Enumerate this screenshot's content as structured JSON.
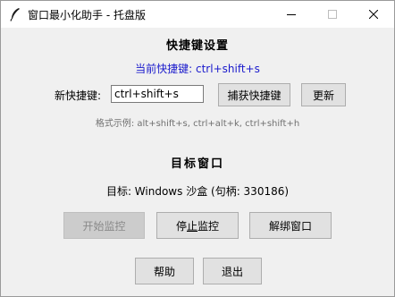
{
  "window": {
    "title": "窗口最小化助手 - 托盘版"
  },
  "hotkey_section": {
    "heading": "快捷键设置",
    "current_label": "当前快捷键: ctrl+shift+s",
    "new_label": "新快捷键:",
    "input_value": "ctrl+shift+s",
    "capture_button": "捕获快捷键",
    "update_button": "更新",
    "format_hint": "格式示例: alt+shift+s, ctrl+alt+k, ctrl+shift+h"
  },
  "target_section": {
    "heading": "目标窗口",
    "target_info": "目标: Windows 沙盒 (句柄: 330186)"
  },
  "monitor_buttons": {
    "start": "开始监控",
    "stop_prefix": "停",
    "stop_underlined": "止",
    "stop_suffix": "监控",
    "unbind": "解绑窗口"
  },
  "bottom_buttons": {
    "help": "帮助",
    "exit": "退出"
  },
  "colors": {
    "accent_text": "#1a1acc",
    "disabled_text": "#8a8a8a",
    "button_face": "#e1e1e1"
  }
}
